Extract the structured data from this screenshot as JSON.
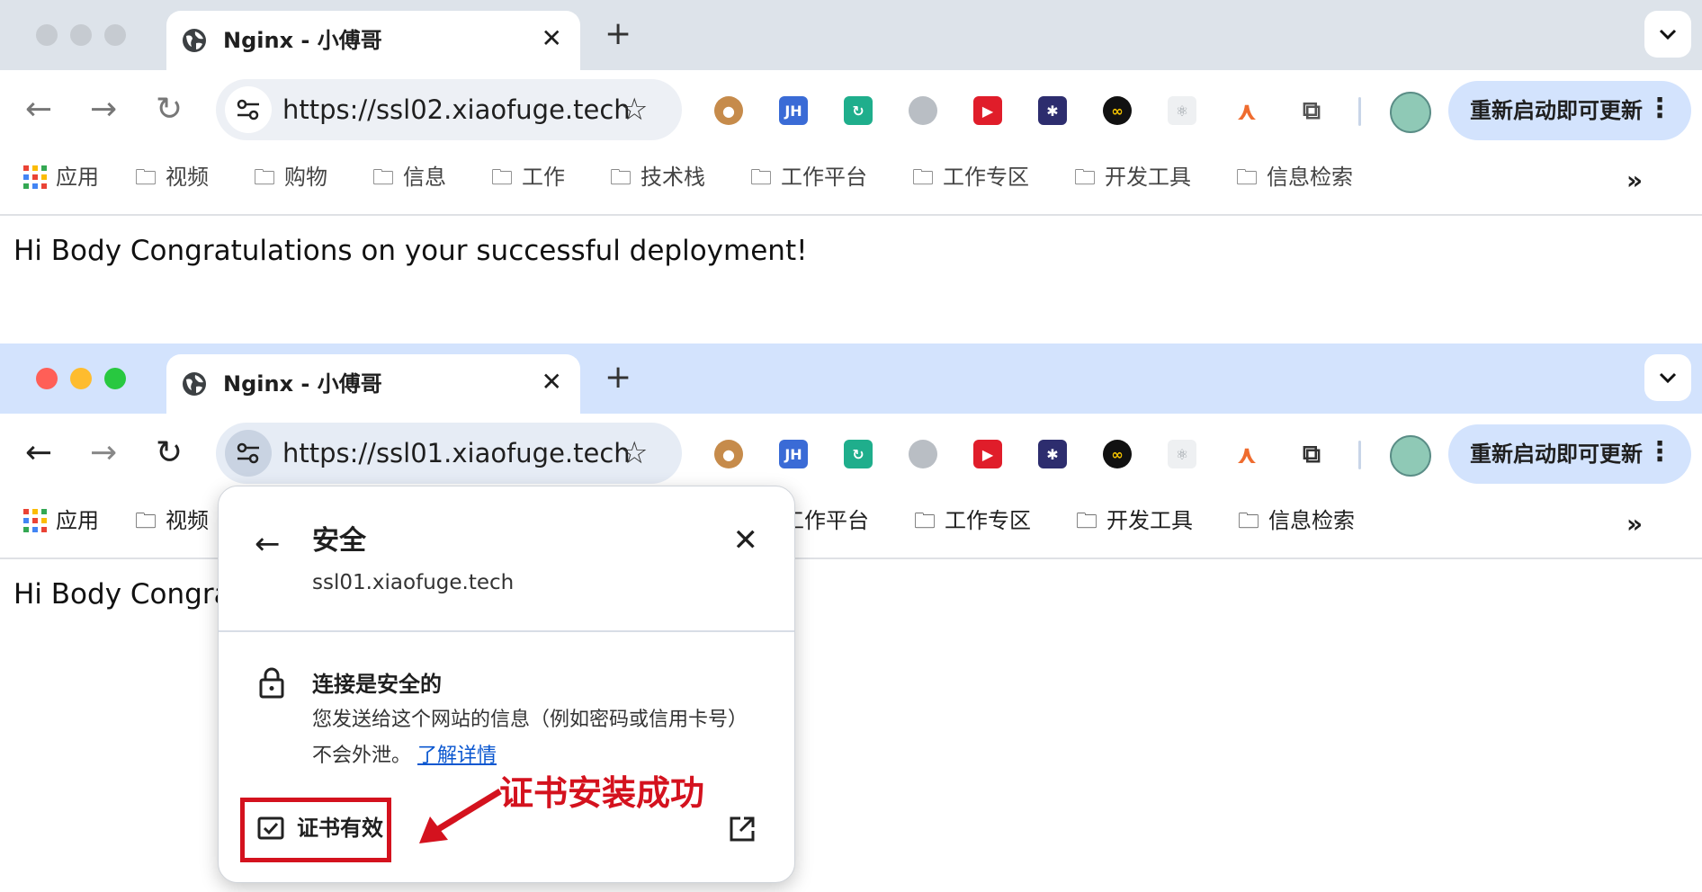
{
  "colors": {
    "annotation_red": "#d4121e",
    "link_blue": "#0b57d0",
    "tabstrip_inactive": "#dde3ea",
    "tabstrip_active": "#d3e3fd"
  },
  "window_back": {
    "tab": {
      "title": "Nginx - 小傅哥",
      "icon": "globe-icon"
    },
    "url": "https://ssl02.xiaofuge.tech",
    "update_button": "重新启动即可更新",
    "bookmarks": [
      "应用",
      "视频",
      "购物",
      "信息",
      "工作",
      "技术栈",
      "工作平台",
      "工作专区",
      "开发工具",
      "信息检索"
    ],
    "page_text": "Hi Body Congratulations on your successful deployment!"
  },
  "window_front": {
    "tab": {
      "title": "Nginx - 小傅哥",
      "icon": "globe-icon"
    },
    "url": "https://ssl01.xiaofuge.tech",
    "update_button": "重新启动即可更新",
    "bookmarks": [
      "应用",
      "视频",
      "工作平台",
      "工作专区",
      "开发工具",
      "信息检索"
    ],
    "page_text": "Hi Body Congra"
  },
  "security_popup": {
    "title": "安全",
    "domain": "ssl01.xiaofuge.tech",
    "connection_title": "连接是安全的",
    "connection_desc": "您发送给这个网站的信息（例如密码或信用卡号）不会外泄。",
    "learn_more": "了解详情",
    "certificate": "证书有效"
  },
  "annotation": "证书安装成功"
}
